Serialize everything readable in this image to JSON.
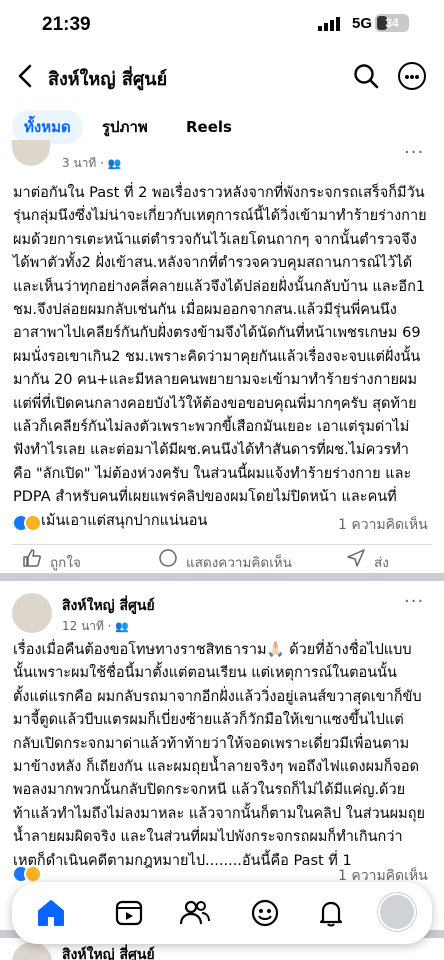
{
  "status_bar": {
    "time": "21:39",
    "network": "5G",
    "battery": "34",
    "battery_level": 0.34
  },
  "header": {
    "back_icon": "chevron-left-icon",
    "title": "สิงห์ใหญ่ สี่ศูนย์",
    "search_icon": "search-icon",
    "more_icon": "more-icon"
  },
  "tabs": [
    {
      "label": "ทั้งหมด",
      "active": true
    },
    {
      "label": "รูปภาพ",
      "active": false
    },
    {
      "label": "Reels",
      "active": false
    }
  ],
  "post1": {
    "timestamp": "3 นาที ·",
    "lines": [
      "มาต่อกันใน Past ที่ 2 พอเรื่องราวหลังจากที่พังกระจกรถเสร็จก็มีวัน",
      "รุ่นกลุ่มนึงซึ่งไม่น่าจะเกี่ยวกับเหตุการณ์นี้ได้วิ่งเข้ามาทำร้ายร่างกาย",
      "ผมด้วยการเตะหน้าแต่ตำรวจกันไว้เลยโดนถากๆ จากนั้นตำรวจจึง",
      "ได้พาตัวทั้ง2 ฝั่งเข้าสน.หลังจากที่ตำรวจควบคุมสถานการณ์ไว้ได้",
      "และเห็นว่าทุกอย่างคลี่คลายแล้วจึงได้ปล่อยฝั่งนั้นกลับบ้าน และอีก1",
      "ชม.จึงปล่อยผมกลับเช่นกัน เมื่อผมออกจากสน.แล้วมีรุ่นพี่คนนึง",
      "อาสาพาไปเคลียร์กันกับฝั่งตรงข้ามจึงได้นัดกันที่หน้าเพชรเกษม 69",
      "ผมนั่งรอเขาเกิน2 ชม.เพราะคิดว่ามาคุยกันแล้วเรื่องจะจบแต่ฝั่งนั้น",
      "มากัน 20 คน+และมีหลายคนพยายามจะเข้ามาทำร้ายร่างกายผม",
      "แต่พี่ที่เปิดคนกลางคอยบังไว้ให้ต้องขอขอบคุณพี่มากๆครับ สุดท้าย",
      "แล้วก็เคลียร์กันไม่ลงตัวเพราะพวกขี้เสือกมันเยอะ เอาแต่รุมด่าไม่",
      "ฟังทำไรเลย และต่อมาได้มีผช.คนนึงได้ทำสันดารที่ผช.ไม่ควรทำ",
      "คือ \"ลักเปิด\" ไม่ต้องห่วงครับ ในส่วนนี้ผมแจ้งทำร้ายร่างกาย และ",
      "PDPA สำหรับคนที่เผยแพร่คลิปของผมโดยไม่ปิดหน้า และคนที่",
      "คอมเม้นเอาแต่สนุกปากแน่นอน"
    ],
    "comments": "1 ความคิดเห็น",
    "actions": {
      "like": "ถูกใจ",
      "comment": "แสดงความคิดเห็น",
      "share": "ส่ง"
    }
  },
  "post2": {
    "author": "สิงห์ใหญ่ สี่ศูนย์",
    "timestamp": "12 นาที ·",
    "lines": [
      "เรื่องเมื่อคืนต้องขอโทษทางราชสิทธาราม🙏🏻 ด้วยที่อ้างชื่อไปแบบ",
      "นั้นเพราะผมใช้ชื่อนี้มาตั้งแต่ตอนเรียน แต่เหตุการณ์ในตอนนั้น",
      "ตั้งแต่แรกคือ ผมกลับรถมาจากอีกฝั่งแล้ววิ่งอยู่เลนส์ขวาสุดเขาก็ขับ",
      "มาจี้ตูดแล้วบีบแตรผมก็เบี่ยงซ้ายแล้วก็วักมือให้เขาแซงขึ้นไปแต่",
      "กลับเปิดกระจกมาด่าแล้วท้าท้ายว่าให้จอดเพราะเดี่ยวมีเพื่อนตาม",
      "มาข้างหลัง ก็เถียงกัน และผมถุยน้ำลายจริงๆ พอถึงไฟแดงผมก็จอด",
      "พอลงมากพวกนั้นกลับปิดกระจกหนี แล้วในรถก็ไม่ได้มีแค่ญ.ด้วย",
      "ท้าแล้วทำไมถึงไม่ลงมาหละ แล้วจากนั้นก็ตามในคลิป ในส่วนผมถุย",
      "น้ำลายผมผิดจริง และในส่วนที่ผมไปพังกระจกรถผมก็ทำเกินกว่า",
      "เหตุก็ดำเนินคดีตามกฎหมายไป........อันนี้คือ Past ที่ 1"
    ],
    "comments": "1 ความคิดเห็น"
  },
  "post3": {
    "author": "สิงห์ใหญ่ สี่ศูนย์"
  },
  "bottom_nav": [
    "home-icon",
    "video-icon",
    "friends-icon",
    "marketplace-icon",
    "bell-icon",
    "profile-avatar"
  ]
}
